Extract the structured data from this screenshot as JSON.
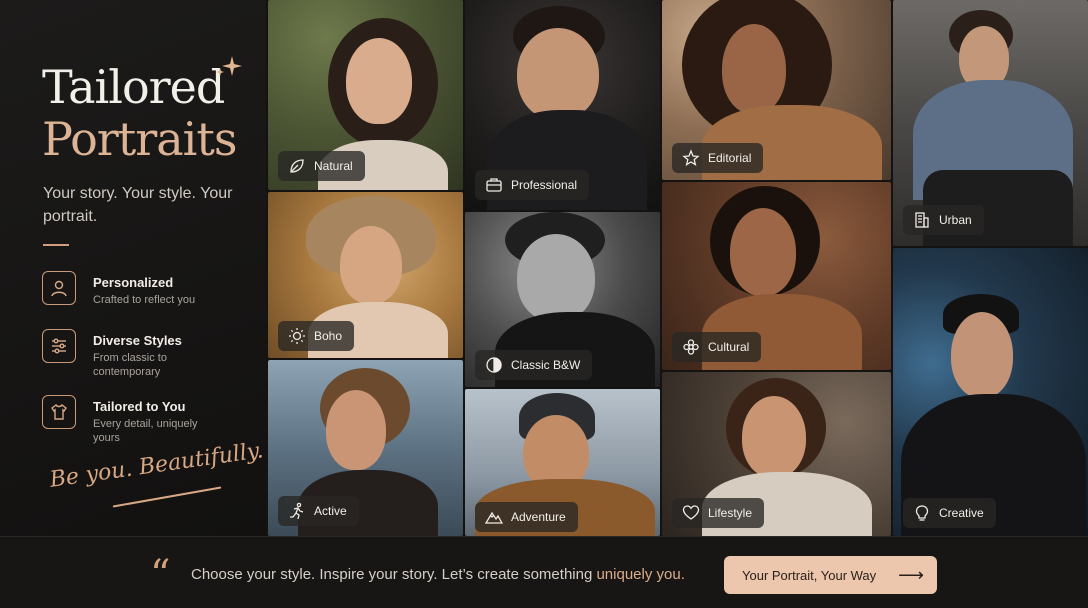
{
  "brand": {
    "title_line1": "Tailored",
    "title_line2": "Portraits",
    "tagline": "Your story. Your style. Your portrait.",
    "script_tagline": "Be you. Beautifully."
  },
  "features": [
    {
      "icon": "person-icon",
      "title": "Personalized",
      "desc": "Crafted to reflect you"
    },
    {
      "icon": "sliders-icon",
      "title": "Diverse Styles",
      "desc": "From classic to contemporary"
    },
    {
      "icon": "tshirt-icon",
      "title": "Tailored to You",
      "desc": "Every detail, uniquely yours"
    }
  ],
  "tiles": [
    {
      "label": "Natural",
      "icon": "leaf-icon"
    },
    {
      "label": "Professional",
      "icon": "briefcase-icon"
    },
    {
      "label": "Editorial",
      "icon": "star-icon"
    },
    {
      "label": "Urban",
      "icon": "building-icon"
    },
    {
      "label": "Boho",
      "icon": "sun-icon"
    },
    {
      "label": "Classic B&W",
      "icon": "contrast-icon"
    },
    {
      "label": "Cultural",
      "icon": "flower-icon"
    },
    {
      "label": "Creative",
      "icon": "lightbulb-icon"
    },
    {
      "label": "Active",
      "icon": "running-icon"
    },
    {
      "label": "Adventure",
      "icon": "mountain-icon"
    },
    {
      "label": "Lifestyle",
      "icon": "heart-icon"
    }
  ],
  "footer": {
    "quote_glyph": "“",
    "text_main": "Choose your style. Inspire your story. Let’s create something ",
    "text_accent": "uniquely you.",
    "cta_label": "Your Portrait, Your Way",
    "cta_arrow": "⟶"
  },
  "colors": {
    "accent": "#dcb395",
    "background": "#141312",
    "cta_bg": "#ecc7ae"
  }
}
